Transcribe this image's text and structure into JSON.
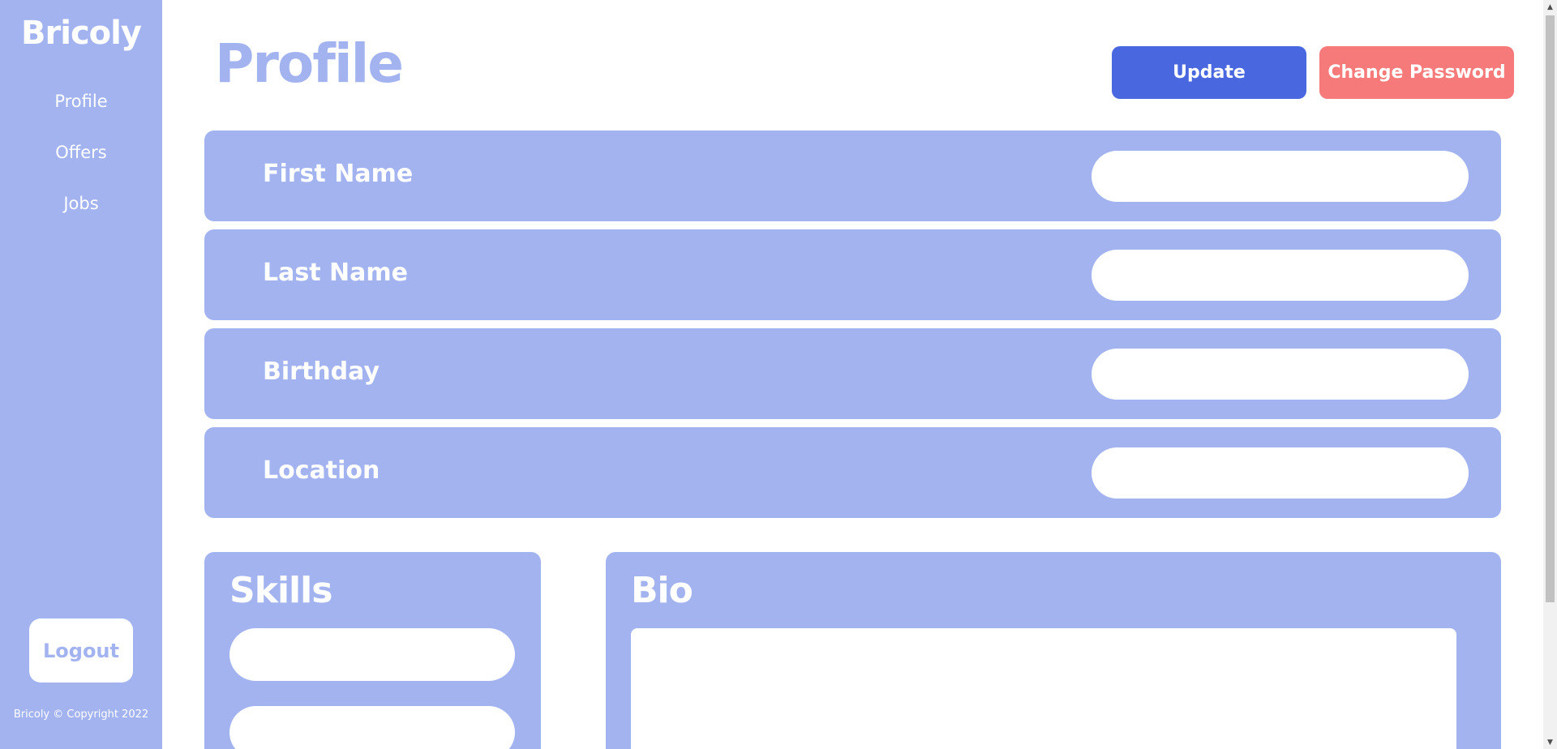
{
  "sidebar": {
    "brand": "Bricoly",
    "nav": [
      {
        "label": "Profile"
      },
      {
        "label": "Offers"
      },
      {
        "label": "Jobs"
      }
    ],
    "logout_label": "Logout",
    "copyright": "Bricoly © Copyright 2022"
  },
  "header": {
    "title": "Profile",
    "update_label": "Update",
    "change_password_label": "Change Password"
  },
  "fields": [
    {
      "label": "First Name",
      "value": ""
    },
    {
      "label": "Last Name",
      "value": ""
    },
    {
      "label": "Birthday",
      "value": ""
    },
    {
      "label": "Location",
      "value": ""
    }
  ],
  "skills": {
    "title": "Skills",
    "items": [
      "",
      ""
    ]
  },
  "bio": {
    "title": "Bio",
    "value": ""
  },
  "colors": {
    "primary": "#a2b3f0",
    "update_button": "#4968e0",
    "change_password_button": "#f67a7a",
    "text_on_primary": "#ffffff"
  }
}
